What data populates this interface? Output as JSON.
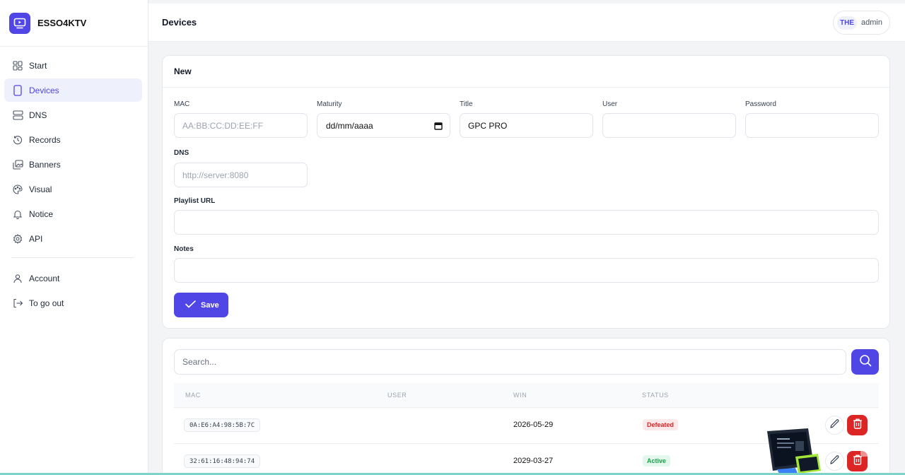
{
  "app": {
    "brand": "ESSO4KTV"
  },
  "sidebar": {
    "items": [
      {
        "label": "Start",
        "icon": "grid-icon"
      },
      {
        "label": "Devices",
        "icon": "device-icon",
        "active": true
      },
      {
        "label": "DNS",
        "icon": "server-icon"
      },
      {
        "label": "Records",
        "icon": "history-icon"
      },
      {
        "label": "Banners",
        "icon": "images-icon"
      },
      {
        "label": "Visual",
        "icon": "palette-icon"
      },
      {
        "label": "Notice",
        "icon": "bell-icon"
      },
      {
        "label": "API",
        "icon": "gear-icon"
      }
    ],
    "bottom_items": [
      {
        "label": "Account",
        "icon": "user-icon"
      },
      {
        "label": "To go out",
        "icon": "logout-icon"
      }
    ]
  },
  "header": {
    "title": "Devices",
    "user_initials": "THE",
    "user_name": "admin"
  },
  "form": {
    "title": "New",
    "mac_label": "MAC",
    "mac_placeholder": "AA:BB:CC:DD:EE:FF",
    "maturity_label": "Maturity",
    "maturity_value": "dd/mm/aaaa",
    "title_label": "Title",
    "title_value": "GPC PRO",
    "user_label": "User",
    "user_value": "",
    "password_label": "Password",
    "password_value": "",
    "dns_label": "DNS",
    "dns_placeholder": "http://server:8080",
    "playlist_label": "Playlist URL",
    "playlist_value": "",
    "notes_label": "Notes",
    "notes_value": "",
    "save_label": "Save"
  },
  "list": {
    "search_placeholder": "Search...",
    "columns": [
      "MAC",
      "USER",
      "WIN",
      "STATUS"
    ],
    "rows": [
      {
        "mac": "0A:E6:A4:98:5B:7C",
        "user": "",
        "win": "2026-05-29",
        "status": "Defeated",
        "status_kind": "danger"
      },
      {
        "mac": "32:61:16:48:94:74",
        "user": "",
        "win": "2029-03-27",
        "status": "Active",
        "status_kind": "success"
      }
    ]
  },
  "colors": {
    "accent": "#4f46e5",
    "danger": "#dc2626",
    "success": "#16a34a"
  }
}
